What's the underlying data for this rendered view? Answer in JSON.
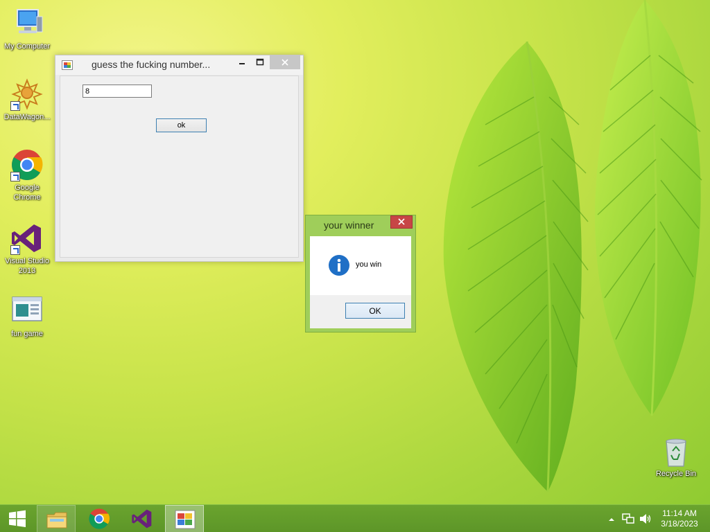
{
  "colors": {
    "taskbar": "#5d9628",
    "window_border": "#c7c7c7",
    "msgbox_frame": "#9fce5a",
    "close_red": "#c74646",
    "info_blue": "#1f6fc6"
  },
  "desktop": {
    "icons": [
      {
        "label": "My Computer",
        "icon": "computer-icon"
      },
      {
        "label": "DataWagon...",
        "icon": "datawagon-icon"
      },
      {
        "label": "Google Chrome",
        "icon": "chrome-icon"
      },
      {
        "label": "Visual Studio 2013",
        "icon": "visual-studio-icon"
      },
      {
        "label": "fun game",
        "icon": "app-window-icon"
      }
    ],
    "recycle_bin": {
      "label": "Recycle Bin",
      "icon": "recycle-bin-icon"
    }
  },
  "main_window": {
    "title": "guess the fucking number...",
    "input_value": "8",
    "ok_label": "ok"
  },
  "message_box": {
    "title": "your winner",
    "text": "you win",
    "ok_label": "OK",
    "icon": "info-icon"
  },
  "taskbar": {
    "items": [
      {
        "icon": "start-windows-icon"
      },
      {
        "icon": "file-explorer-icon"
      },
      {
        "icon": "chrome-icon"
      },
      {
        "icon": "visual-studio-icon"
      },
      {
        "icon": "app-window-icon"
      }
    ],
    "clock": {
      "time": "11:14 AM",
      "date": "3/18/2023"
    }
  }
}
